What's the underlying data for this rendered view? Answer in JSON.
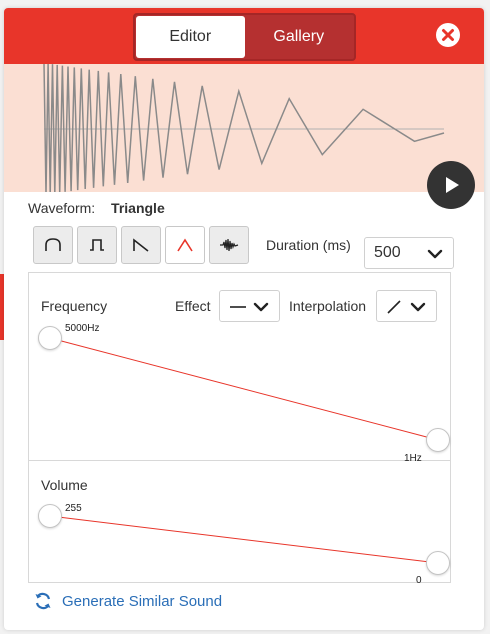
{
  "tabs": {
    "editor": "Editor",
    "gallery": "Gallery"
  },
  "waveform": {
    "label": "Waveform:",
    "value": "Triangle"
  },
  "wave_buttons": [
    "sine-wave-icon",
    "square-wave-icon",
    "sawtooth-wave-icon",
    "triangle-wave-icon",
    "noise-wave-icon"
  ],
  "duration": {
    "label": "Duration (ms)",
    "value": "500"
  },
  "frequency": {
    "label": "Frequency",
    "start": "5000Hz",
    "end": "1Hz"
  },
  "effect": {
    "label": "Effect"
  },
  "interpolation": {
    "label": "Interpolation"
  },
  "volume": {
    "label": "Volume",
    "start": "255",
    "end": "0"
  },
  "generate": {
    "label": "Generate Similar Sound"
  },
  "colors": {
    "accent": "#e8352a",
    "wave_bg": "#fbdfd3",
    "link": "#2a6eb7"
  }
}
